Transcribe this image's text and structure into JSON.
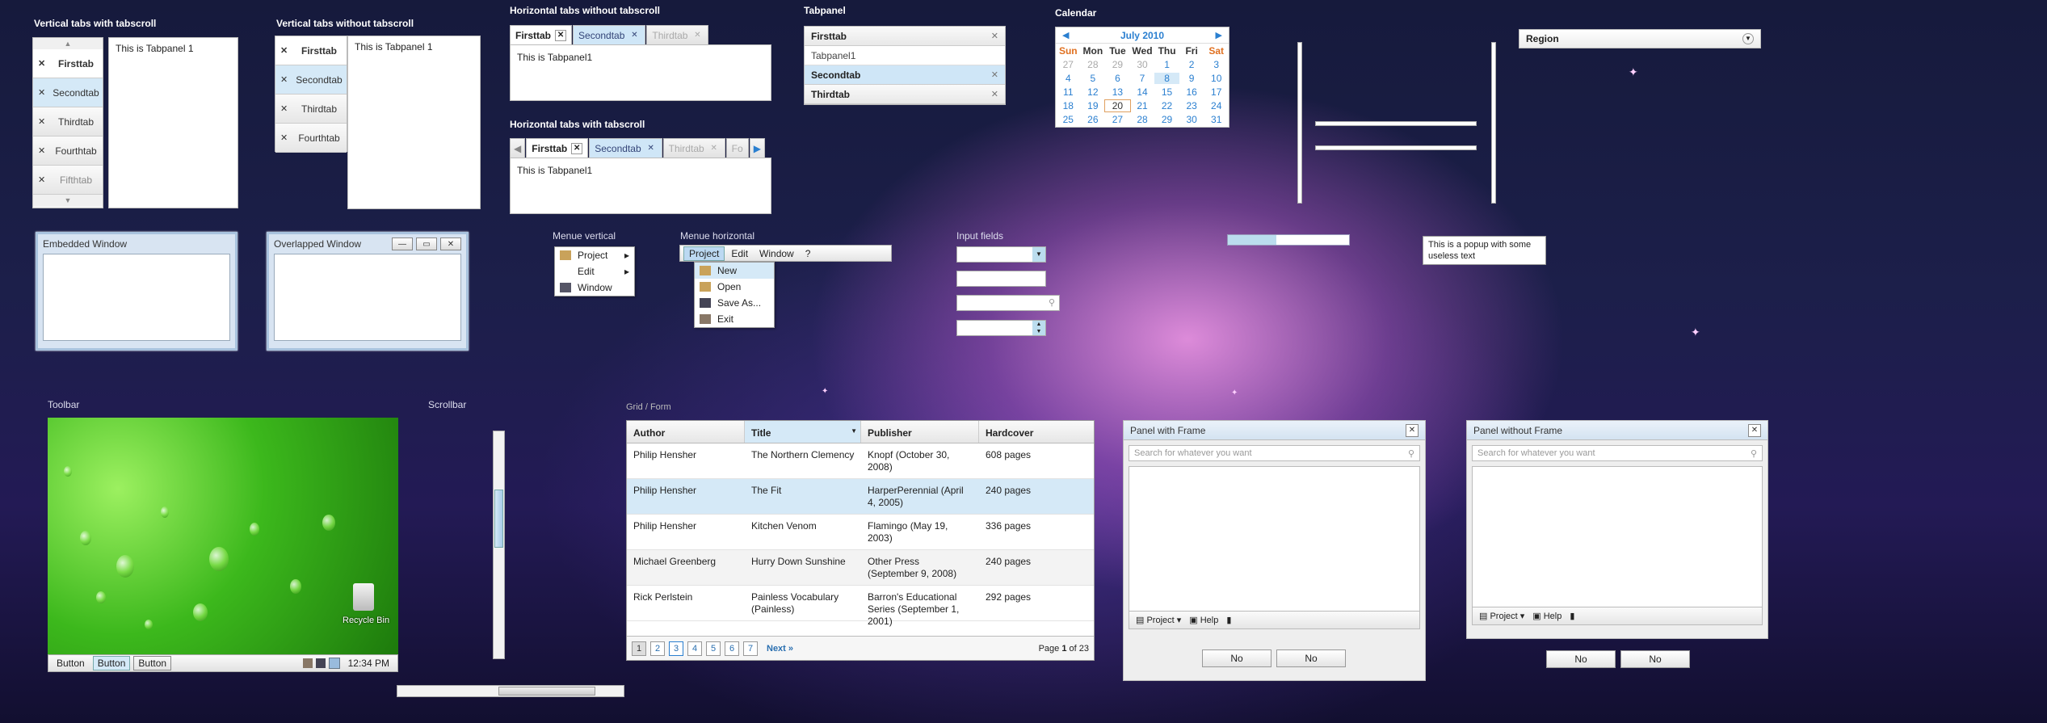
{
  "labels": {
    "vtabs_scroll": "Vertical tabs with tabscroll",
    "vtabs_noscroll": "Vertical tabs without tabscroll",
    "htabs_noscroll": "Horizontal tabs without tabscroll",
    "htabs_scroll": "Horizontal tabs with tabscroll",
    "tabpanel": "Tabpanel",
    "calendar": "Calendar",
    "menu_vertical": "Menue vertical",
    "menu_horizontal": "Menue horizontal",
    "input_fields": "Input fields",
    "toolbar": "Toolbar",
    "scrollbar": "Scrollbar",
    "grid_form": "Grid / Form"
  },
  "vtabs1": {
    "tabs": [
      "Firsttab",
      "Secondtab",
      "Thirdtab",
      "Fourthtab",
      "Fifthtab"
    ],
    "body": "This is Tabpanel 1"
  },
  "vtabs2": {
    "tabs": [
      "Firsttab",
      "Secondtab",
      "Thirdtab",
      "Fourthtab"
    ],
    "body": "This is Tabpanel 1"
  },
  "htabs1": {
    "tabs": [
      "Firsttab",
      "Secondtab",
      "Thirdtab"
    ],
    "body": "This is Tabpanel1"
  },
  "htabs2": {
    "tabs": [
      "Firsttab",
      "Secondtab",
      "Thirdtab",
      "Fo"
    ],
    "body": "This is Tabpanel1"
  },
  "accordion": {
    "first": "Firsttab",
    "body": "Tabpanel1",
    "second": "Secondtab",
    "third": "Thirdtab"
  },
  "calendar": {
    "month": "July 2010",
    "days": [
      "Sun",
      "Mon",
      "Tue",
      "Wed",
      "Thu",
      "Fri",
      "Sat"
    ],
    "weeks": [
      [
        "27",
        "28",
        "29",
        "30",
        "1",
        "2",
        "3"
      ],
      [
        "4",
        "5",
        "6",
        "7",
        "8",
        "9",
        "10"
      ],
      [
        "11",
        "12",
        "13",
        "14",
        "15",
        "16",
        "17"
      ],
      [
        "18",
        "19",
        "20",
        "21",
        "22",
        "23",
        "24"
      ],
      [
        "25",
        "26",
        "27",
        "28",
        "29",
        "30",
        "31"
      ]
    ]
  },
  "region": {
    "label": "Region"
  },
  "windows": {
    "embedded": "Embedded Window",
    "overlapped": "Overlapped Window"
  },
  "vmenu": [
    "Project",
    "Edit",
    "Window"
  ],
  "hmenu": {
    "bar": [
      "Project",
      "Edit",
      "Window",
      "?"
    ],
    "items": [
      "New",
      "Open",
      "Save As...",
      "Exit"
    ]
  },
  "popup": {
    "text": "This is a popup with some useless text"
  },
  "toolbar": {
    "buttons": [
      "Button",
      "Button",
      "Button"
    ],
    "time": "12:34 PM",
    "recycle": "Recycle Bin"
  },
  "grid": {
    "columns": [
      "Author",
      "Title",
      "Publisher",
      "Hardcover"
    ],
    "rows": [
      [
        "Philip Hensher",
        "The Northern Clemency",
        "Knopf (October 30, 2008)",
        "608 pages"
      ],
      [
        "Philip Hensher",
        "The Fit",
        "HarperPerennial (April 4, 2005)",
        "240 pages"
      ],
      [
        "Philip Hensher",
        "Kitchen Venom",
        "Flamingo (May 19, 2003)",
        "336 pages"
      ],
      [
        "Michael Greenberg",
        "Hurry Down Sunshine",
        "Other Press (September 9, 2008)",
        "240 pages"
      ],
      [
        "Rick Perlstein",
        "Painless Vocabulary (Painless)",
        "Barron's Educational Series (September 1, 2001)",
        "292 pages"
      ]
    ],
    "pages": [
      "1",
      "2",
      "3",
      "4",
      "5",
      "6",
      "7"
    ],
    "next": "Next »",
    "page_info_a": "Page ",
    "page_cur": "1",
    "page_info_b": " of 23"
  },
  "panel_frame": {
    "title": "Panel with Frame",
    "search": "Search for whatever you want",
    "project": "Project",
    "help": "Help",
    "btn1": "No",
    "btn2": "No"
  },
  "panel_noframe": {
    "title": "Panel without Frame",
    "search": "Search for whatever you want",
    "project": "Project",
    "help": "Help",
    "btn1": "No",
    "btn2": "No"
  },
  "colors": {
    "accent": "#2a7fd0",
    "highlight": "#d5e9f7"
  }
}
